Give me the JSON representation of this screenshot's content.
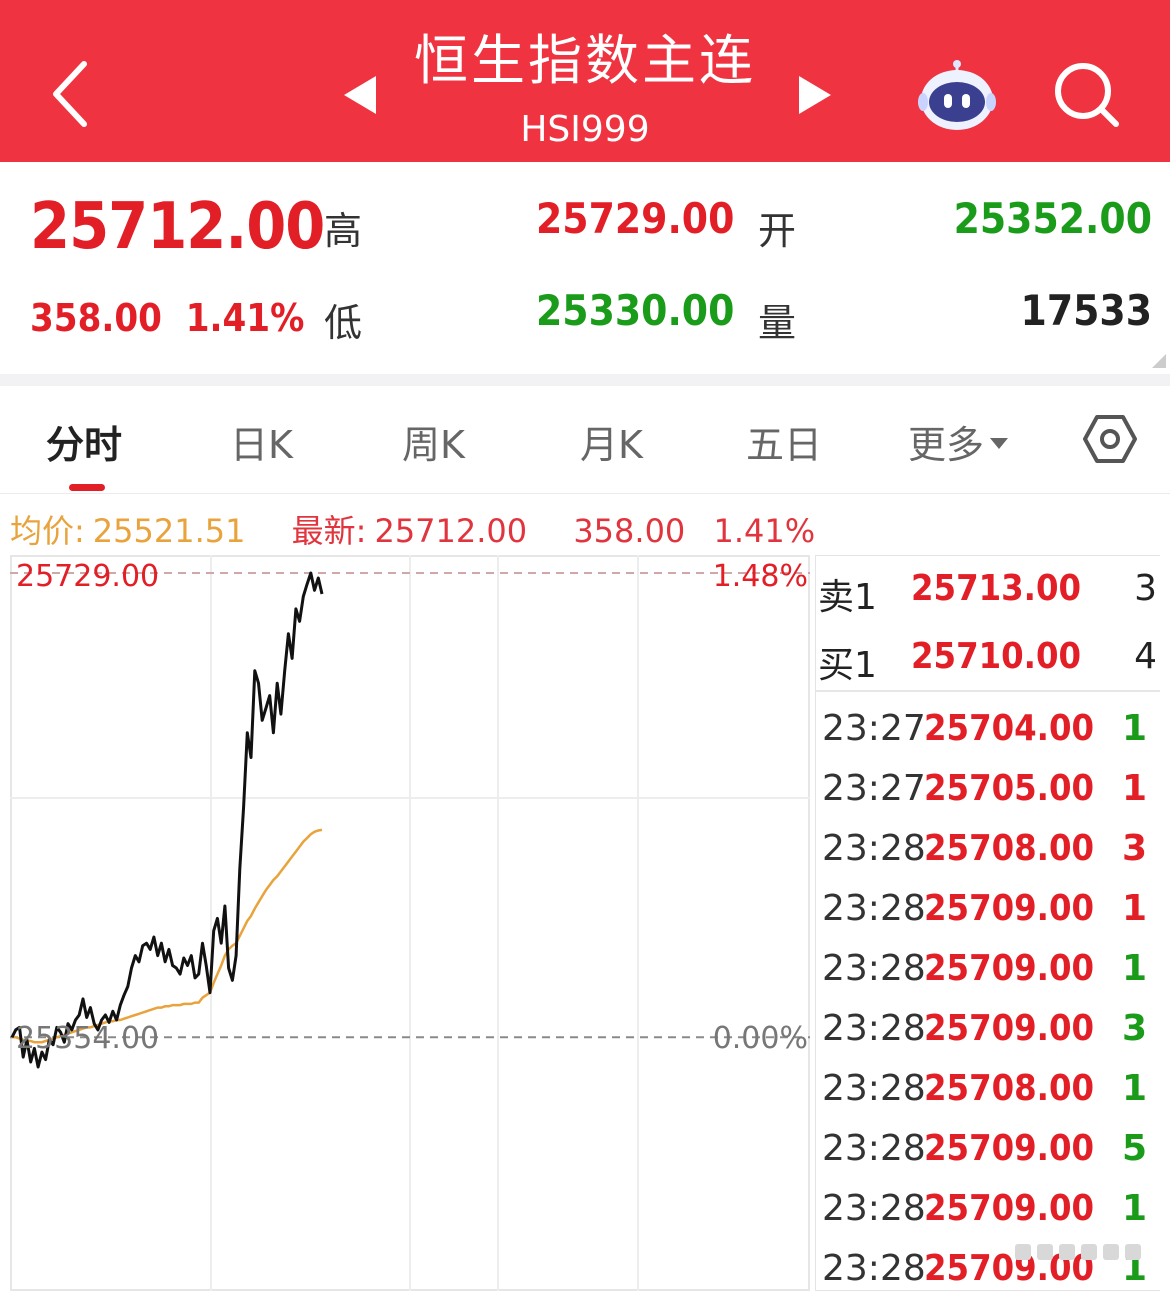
{
  "header": {
    "title": "恒生指数主连",
    "subtitle": "HSI999"
  },
  "quote": {
    "last_price": "25712.00",
    "change": "358.00",
    "change_pct": "1.41%",
    "high_label": "高",
    "high": "25729.00",
    "low_label": "低",
    "low": "25330.00",
    "open_label": "开",
    "open": "25352.00",
    "volume_label": "量",
    "volume": "17533"
  },
  "tabs": [
    {
      "label": "分时",
      "active": true
    },
    {
      "label": "日K"
    },
    {
      "label": "周K"
    },
    {
      "label": "月K"
    },
    {
      "label": "五日"
    },
    {
      "label": "更多"
    }
  ],
  "info": {
    "avg_label": "均价:",
    "avg_value": "25521.51",
    "latest_label": "最新:",
    "latest_value": "25712.00",
    "change": "358.00",
    "change_pct": "1.41%"
  },
  "chart_labels": {
    "top_price": "25729.00",
    "top_pct": "1.48%",
    "base_price": "25354.00",
    "base_pct": "0.00%"
  },
  "chart_data": {
    "type": "line",
    "y_range": [
      25330,
      25729
    ],
    "base_value": 25354.0,
    "series": [
      {
        "values": [
          25354,
          25360,
          25362,
          25338,
          25352,
          25334,
          25345,
          25330,
          25342,
          25336,
          25352,
          25348,
          25362,
          25358,
          25350,
          25365,
          25360,
          25368,
          25372,
          25385,
          25370,
          25378,
          25365,
          25360,
          25368,
          25372,
          25366,
          25375,
          25368,
          25380,
          25388,
          25395,
          25410,
          25420,
          25415,
          25428,
          25430,
          25425,
          25435,
          25420,
          25430,
          25415,
          25425,
          25412,
          25410,
          25405,
          25418,
          25412,
          25420,
          25402,
          25405,
          25430,
          25412,
          25390,
          25440,
          25450,
          25430,
          25460,
          25410,
          25400,
          25420,
          25490,
          25540,
          25600,
          25580,
          25650,
          25640,
          25610,
          25620,
          25630,
          25600,
          25640,
          25615,
          25650,
          25680,
          25660,
          25700,
          25690,
          25710,
          25720,
          25729,
          25715,
          25725,
          25712
        ]
      },
      {
        "values": [
          25354,
          25354,
          25353,
          25352,
          25351,
          25351,
          25350,
          25350,
          25350,
          25351,
          25352,
          25353,
          25354,
          25355,
          25356,
          25357,
          25358,
          25359,
          25360,
          25361,
          25362,
          25362,
          25363,
          25364,
          25365,
          25366,
          25367,
          25367,
          25368,
          25368,
          25369,
          25370,
          25371,
          25372,
          25373,
          25374,
          25375,
          25376,
          25377,
          25378,
          25378,
          25379,
          25379,
          25380,
          25380,
          25380,
          25381,
          25381,
          25381,
          25382,
          25382,
          25386,
          25388,
          25390,
          25398,
          25405,
          25412,
          25420,
          25425,
          25428,
          25430,
          25436,
          25442,
          25448,
          25452,
          25458,
          25463,
          25468,
          25473,
          25477,
          25481,
          25484,
          25488,
          25492,
          25496,
          25500,
          25504,
          25508,
          25512,
          25515,
          25518,
          25520,
          25521,
          25521.51
        ]
      }
    ]
  },
  "order_book": {
    "sell_label": "卖1",
    "sell_price": "25713.00",
    "sell_vol": "3",
    "buy_label": "买1",
    "buy_price": "25710.00",
    "buy_vol": "4"
  },
  "trades": [
    {
      "time": "23:27",
      "price": "25704.00",
      "vol": "1",
      "side": "green"
    },
    {
      "time": "23:27",
      "price": "25705.00",
      "vol": "1",
      "side": "red"
    },
    {
      "time": "23:28",
      "price": "25708.00",
      "vol": "3",
      "side": "red"
    },
    {
      "time": "23:28",
      "price": "25709.00",
      "vol": "1",
      "side": "red"
    },
    {
      "time": "23:28",
      "price": "25709.00",
      "vol": "1",
      "side": "green"
    },
    {
      "time": "23:28",
      "price": "25709.00",
      "vol": "3",
      "side": "green"
    },
    {
      "time": "23:28",
      "price": "25708.00",
      "vol": "1",
      "side": "green"
    },
    {
      "time": "23:28",
      "price": "25709.00",
      "vol": "5",
      "side": "green"
    },
    {
      "time": "23:28",
      "price": "25709.00",
      "vol": "1",
      "side": "green"
    },
    {
      "time": "23:28",
      "price": "25709.00",
      "vol": "1",
      "side": "green"
    }
  ],
  "colors": {
    "header_red": "#ef3340",
    "up_red": "#e21f26",
    "down_green": "#1a9c1a",
    "avg_orange": "#e8a33c",
    "price_line": "#111111"
  }
}
